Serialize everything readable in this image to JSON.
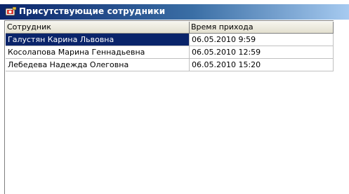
{
  "window": {
    "title": "Присутствующие сотрудники",
    "icon": "app-icon"
  },
  "grid": {
    "columns": [
      "Сотрудник",
      "Время прихода"
    ],
    "rows": [
      {
        "employee": "Галустян Карина Львовна",
        "arrival": "06.05.2010 9:59",
        "selected": true
      },
      {
        "employee": "Косолапова Марина Геннадьевна",
        "arrival": "06.05.2010 12:59",
        "selected": false
      },
      {
        "employee": "Лебедева Надежда  Олеговна",
        "arrival": "06.05.2010 15:20",
        "selected": false
      }
    ]
  },
  "colors": {
    "titlebar_start": "#0a246a",
    "titlebar_end": "#a6caf0",
    "selection": "#0a246a"
  }
}
